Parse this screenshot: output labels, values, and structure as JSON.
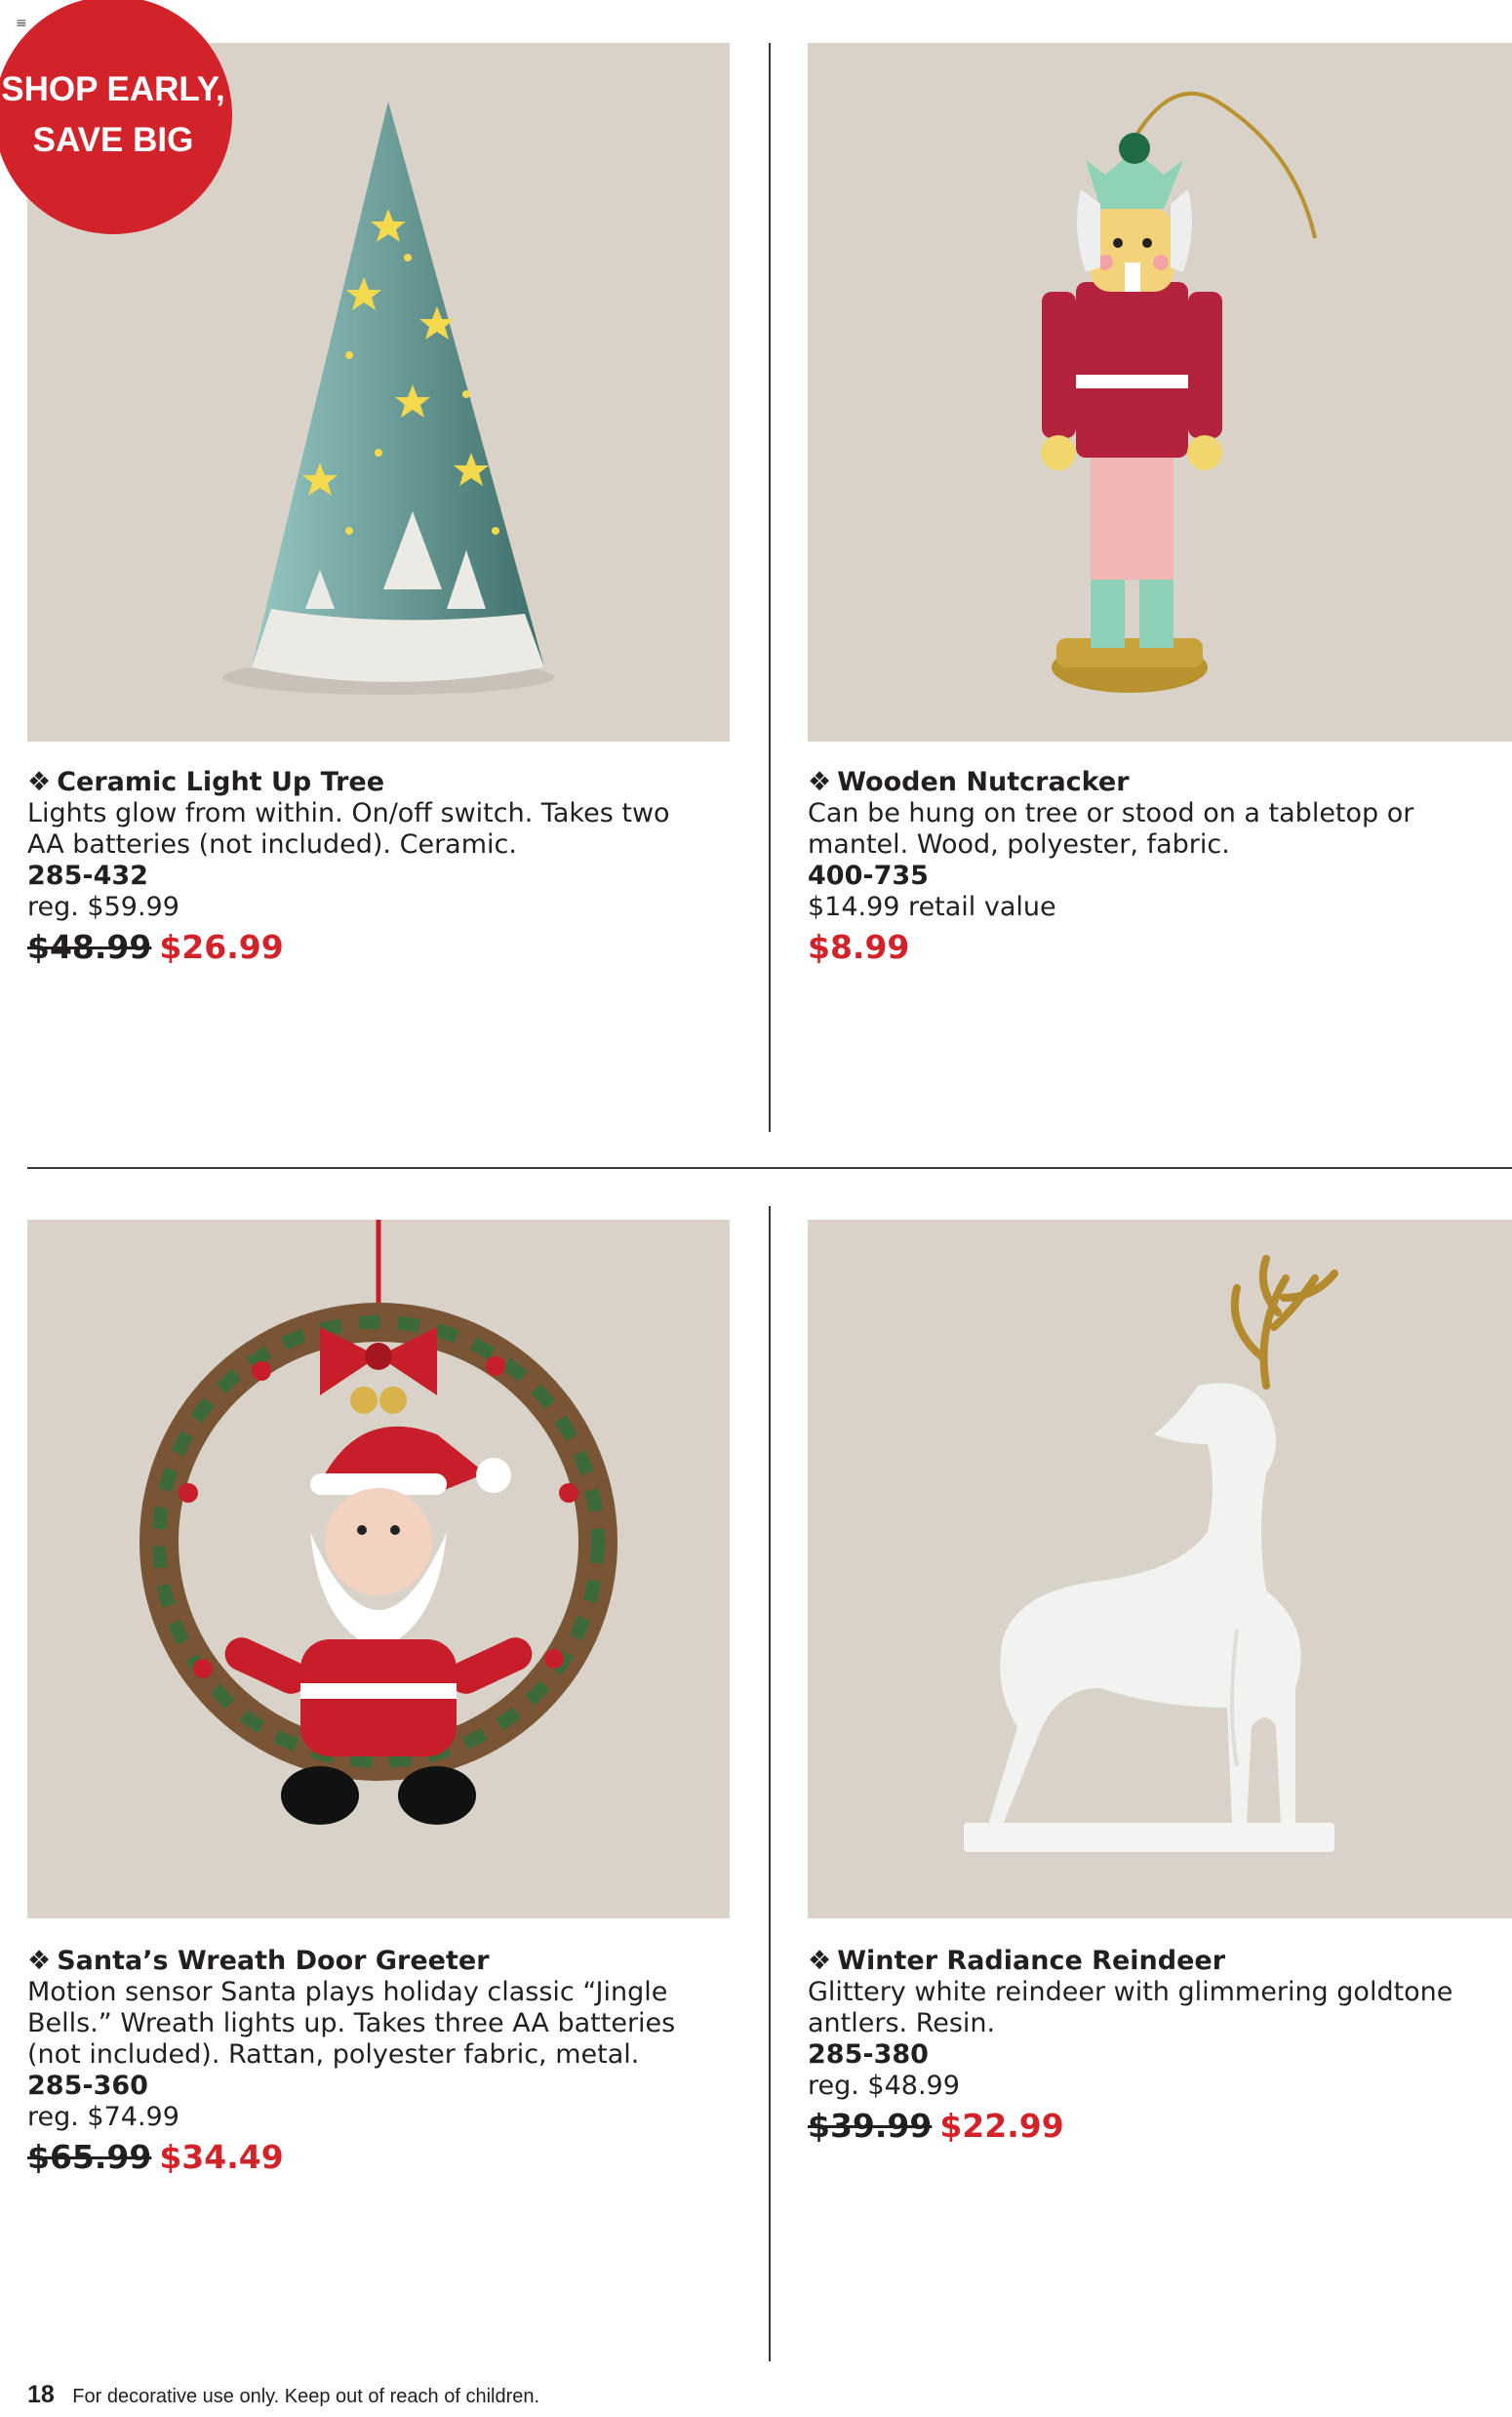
{
  "page": {
    "menu_glyph": "≡",
    "badge": {
      "line1": "SHOP EARLY,",
      "line2": "SAVE BIG"
    },
    "footer": {
      "page_number": "18",
      "note": "For decorative use only. Keep out of reach of children."
    }
  },
  "products": [
    {
      "name": "Ceramic Light Up Tree",
      "bullet": "❖",
      "desc_lines": [
        "Lights glow from within. On/off switch. Takes two",
        "AA batteries (not included). Ceramic."
      ],
      "sku": "285-432",
      "reg": "reg. $59.99",
      "old_price": "$48.99",
      "sale_price": "$26.99"
    },
    {
      "name": "Wooden Nutcracker",
      "bullet": "❖",
      "desc_lines": [
        "Can be hung on tree or stood on a tabletop or",
        "mantel. Wood, polyester, fabric."
      ],
      "sku": "400-735",
      "reg": "$14.99 retail value",
      "old_price": "",
      "sale_price": "$8.99"
    },
    {
      "name": "Santa’s Wreath Door Greeter",
      "bullet": "❖",
      "desc_lines": [
        "Motion sensor Santa plays holiday classic “Jingle",
        "Bells.” Wreath lights up. Takes three AA batteries",
        "(not included). Rattan, polyester fabric, metal."
      ],
      "sku": "285-360",
      "reg": "reg. $74.99",
      "old_price": "$65.99",
      "sale_price": "$34.49"
    },
    {
      "name": "Winter Radiance Reindeer",
      "bullet": "❖",
      "desc_lines": [
        "Glittery white reindeer with glimmering goldtone",
        "antlers. Resin."
      ],
      "sku": "285-380",
      "reg": "reg. $48.99",
      "old_price": "$39.99",
      "sale_price": "$22.99"
    }
  ],
  "colors": {
    "sale_red": "#d2232a",
    "photo_bg": "#d8d1c8",
    "text": "#231f20"
  }
}
